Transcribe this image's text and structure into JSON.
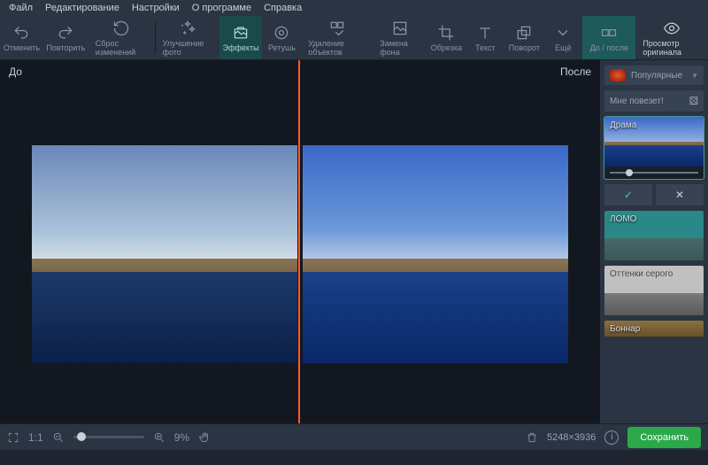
{
  "menu": {
    "file": "Файл",
    "edit": "Редактирование",
    "settings": "Настройки",
    "about": "О программе",
    "help": "Справка"
  },
  "toolbar": {
    "undo": "Отменить",
    "redo": "Повторить",
    "reset": "Сброс изменений",
    "enhance": "Улучшение фото",
    "effects": "Эффекты",
    "retouch": "Ретушь",
    "remove": "Удаление объектов",
    "bg": "Замена фона",
    "crop": "Обрезка",
    "text": "Текст",
    "rotate": "Поворот",
    "more": "Ещё",
    "beforeAfter": "До / после",
    "original": "Просмотр оригинала"
  },
  "canvas": {
    "before": "До",
    "after": "После"
  },
  "panel": {
    "category": "Популярные",
    "lucky": "Мне повезет!",
    "effects": {
      "drama": "Драма",
      "lomo": "ЛОМО",
      "gray": "Оттенки серого",
      "bonnar": "Боннар"
    }
  },
  "status": {
    "fit": "1:1",
    "zoom": "9%",
    "dims": "5248×3936",
    "save": "Сохранить"
  }
}
